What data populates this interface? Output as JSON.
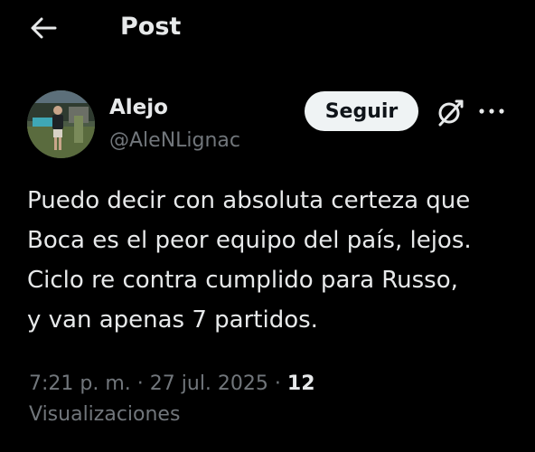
{
  "header": {
    "title": "Post",
    "back_icon": "arrow-left-icon"
  },
  "author": {
    "display_name": "Alejo",
    "handle": "@AleNLignac",
    "avatar_icon": "avatar-photo"
  },
  "actions": {
    "follow_label": "Seguir",
    "grok_icon": "grok-icon",
    "more_icon": "more-options-icon"
  },
  "tweet": {
    "lines": [
      "Puedo decir con absoluta certeza que",
      "Boca es el peor equipo del país, lejos.",
      "Ciclo re contra cumplido para Russo,",
      "y van apenas 7 partidos."
    ]
  },
  "meta": {
    "time": "7:21 p. m.",
    "separator": "·",
    "date": "27 jul. 2025",
    "views_count": "12",
    "views_label": "Visualizaciones"
  },
  "colors": {
    "background": "#000000",
    "primary_text": "#e7e9ea",
    "secondary_text": "#71767b",
    "follow_button_bg": "#eff3f4",
    "follow_button_text": "#0f1419"
  }
}
